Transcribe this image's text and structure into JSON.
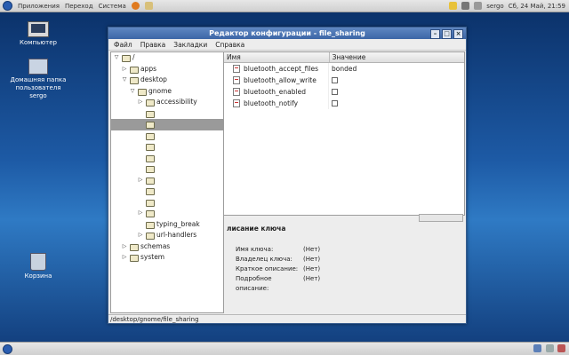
{
  "topbar": {
    "menus": [
      "Приложения",
      "Переход",
      "Система"
    ],
    "user": "sergo",
    "clock": "Сб, 24 Май, 21:59"
  },
  "desktop": {
    "icons": [
      {
        "label": "Компьютер"
      },
      {
        "label": "Домашняя папка пользователя sergo"
      },
      {
        "label": "Корзина"
      }
    ]
  },
  "window": {
    "title": "Редактор конфигурации - file_sharing",
    "menu": [
      "Файл",
      "Правка",
      "Закладки",
      "Справка"
    ],
    "tree": [
      {
        "indent": 0,
        "expanded": true,
        "label": "/"
      },
      {
        "indent": 1,
        "expanded": false,
        "label": "apps"
      },
      {
        "indent": 1,
        "expanded": true,
        "label": "desktop"
      },
      {
        "indent": 2,
        "expanded": true,
        "label": "gnome"
      },
      {
        "indent": 3,
        "expanded": false,
        "label": "accessibility"
      },
      {
        "indent": 3,
        "expanded": null,
        "label": ""
      },
      {
        "indent": 3,
        "expanded": null,
        "label": "",
        "selected": true
      },
      {
        "indent": 3,
        "expanded": null,
        "label": ""
      },
      {
        "indent": 3,
        "expanded": null,
        "label": ""
      },
      {
        "indent": 3,
        "expanded": null,
        "label": ""
      },
      {
        "indent": 3,
        "expanded": null,
        "label": ""
      },
      {
        "indent": 3,
        "expanded": false,
        "label": ""
      },
      {
        "indent": 3,
        "expanded": null,
        "label": ""
      },
      {
        "indent": 3,
        "expanded": null,
        "label": ""
      },
      {
        "indent": 3,
        "expanded": false,
        "label": ""
      },
      {
        "indent": 3,
        "expanded": null,
        "label": "typing_break"
      },
      {
        "indent": 3,
        "expanded": false,
        "label": "url-handlers"
      },
      {
        "indent": 1,
        "expanded": false,
        "label": "schemas"
      },
      {
        "indent": 1,
        "expanded": false,
        "label": "system"
      }
    ],
    "columns": {
      "name": "Имя",
      "value": "Значение"
    },
    "keys": [
      {
        "name": "bluetooth_accept_files",
        "value": "bonded",
        "checkbox": false
      },
      {
        "name": "bluetooth_allow_write",
        "value": "",
        "checkbox": true
      },
      {
        "name": "bluetooth_enabled",
        "value": "",
        "checkbox": true
      },
      {
        "name": "bluetooth_notify",
        "value": "",
        "checkbox": true
      }
    ],
    "details": {
      "heading": "лисание ключа",
      "rows": [
        {
          "label": "Имя ключа:",
          "value": "(Нет)"
        },
        {
          "label": "Владелец ключа:",
          "value": "(Нет)"
        },
        {
          "label": "Краткое описание:",
          "value": "(Нет)"
        },
        {
          "label": "Подробное описание:",
          "value": "(Нет)"
        }
      ]
    },
    "status": "/desktop/gnome/file_sharing"
  }
}
